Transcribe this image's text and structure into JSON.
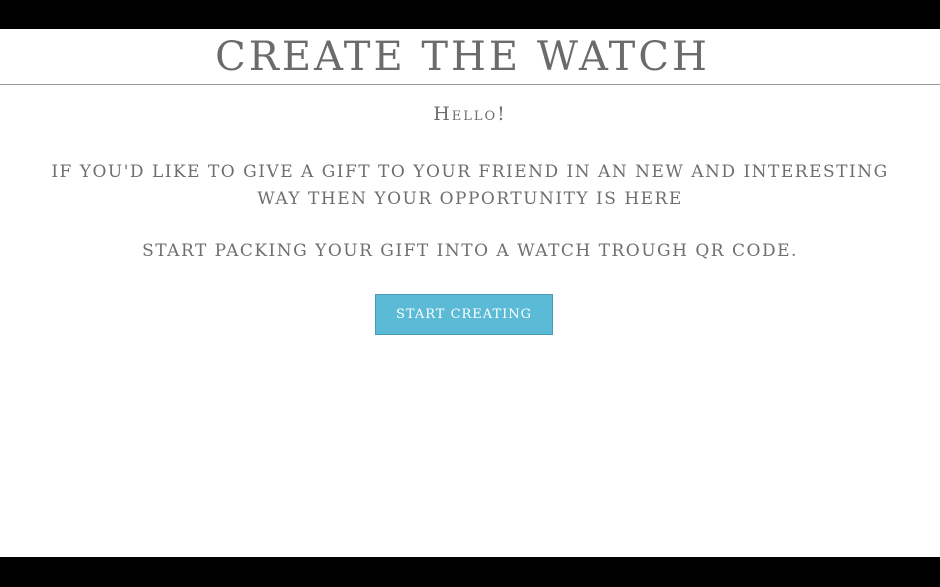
{
  "header": {
    "title": "CREATE THE WATCH"
  },
  "main": {
    "greeting": "Hello!",
    "intro": "IF YOU'D LIKE TO GIVE A GIFT TO YOUR FRIEND IN AN NEW AND INTERESTING WAY  THEN YOUR OPPORTUNITY IS HERE",
    "cta_text": "START PACKING YOUR GIFT INTO A WATCH TROUGH QR CODE.",
    "start_button_label": "START CREATING"
  },
  "colors": {
    "accent": "#5bbad6",
    "text": "#6e6e6e",
    "letterbox": "#000000"
  }
}
